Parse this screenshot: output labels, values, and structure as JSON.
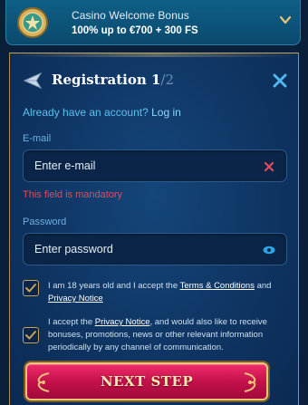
{
  "bonus": {
    "title": "Casino Welcome Bonus",
    "subtitle": "100% up to €700 + 300 FS"
  },
  "registration": {
    "title": "Registration 1",
    "step": "/2",
    "login_prompt": "Already have an account?",
    "login_link": "Log in"
  },
  "email": {
    "label": "E-mail",
    "placeholder": "Enter e-mail",
    "value": "",
    "error": "This field is mandatory"
  },
  "password": {
    "label": "Password",
    "placeholder": "Enter password",
    "value": ""
  },
  "terms": {
    "checked": true,
    "text_before": "I am 18 years old and I accept the ",
    "terms_link": "Terms & Conditions",
    "text_and": " and ",
    "privacy_link": "Privacy Notice"
  },
  "marketing": {
    "checked": true,
    "text_before": "I accept the ",
    "privacy_link": "Privacy Notice",
    "text_after": ", and would also like to receive bonuses, promotions, news or other relevant information periodically by any channel of communication."
  },
  "next_button": {
    "label": "NEXT STEP"
  },
  "colors": {
    "accent_blue": "#5ec1f0",
    "error_red": "#e54a5a",
    "gold": "#c7a25a",
    "button_red": "#c4114c"
  },
  "icons": {
    "back": "back-arrow-icon",
    "close": "close-icon",
    "clear": "clear-x-icon",
    "eye": "eye-icon",
    "chevron": "chevron-down-icon",
    "coin": "coin-icon"
  }
}
